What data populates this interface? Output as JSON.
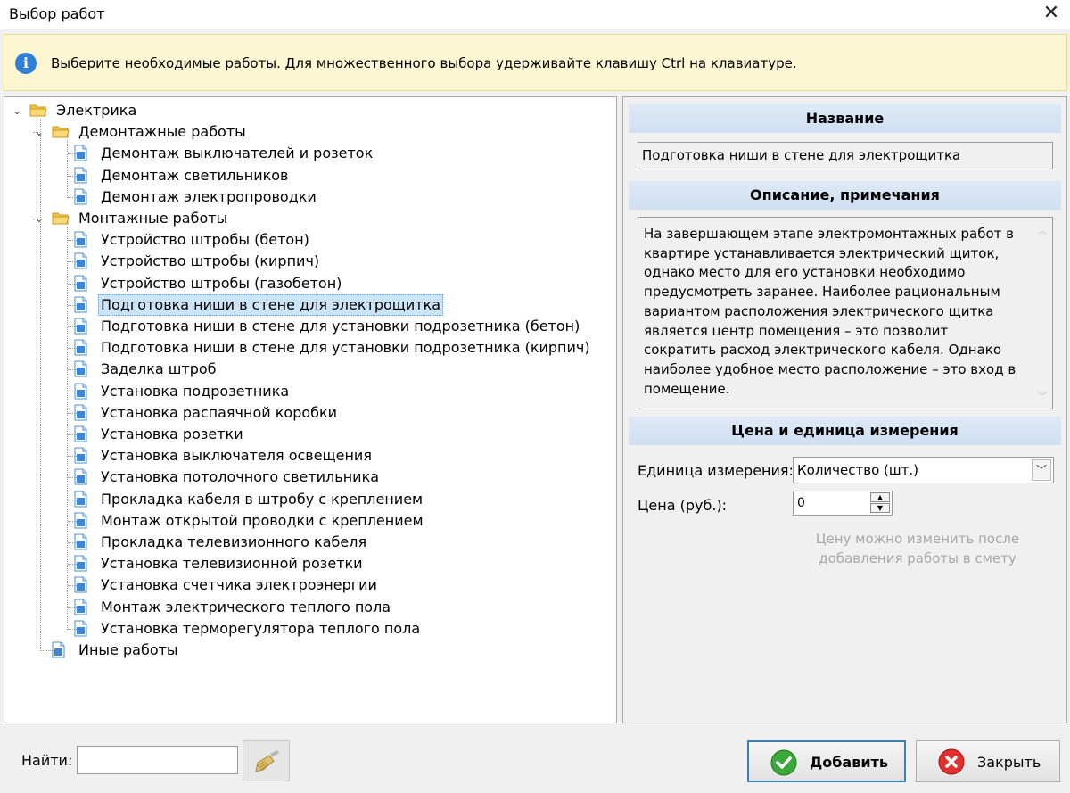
{
  "window": {
    "title": "Выбор работ",
    "close_glyph": "✕"
  },
  "info": {
    "icon": "info-icon",
    "message": "Выберите необходимые работы. Для множественного выбора удерживайте клавишу Ctrl на клавиатуре."
  },
  "tree": {
    "root": {
      "label": "Электрика",
      "expanded": true
    },
    "groups": [
      {
        "label": "Демонтажные работы",
        "expanded": true,
        "items": [
          "Демонтаж выключателей и розеток",
          "Демонтаж светильников",
          "Демонтаж электропроводки"
        ]
      },
      {
        "label": "Монтажные работы",
        "expanded": true,
        "items": [
          "Устройство штробы (бетон)",
          "Устройство штробы (кирпич)",
          "Устройство штробы (газобетон)",
          "Подготовка ниши в стене для электрощитка",
          "Подготовка ниши в стене для установки подрозетника (бетон)",
          "Подготовка ниши в стене для установки подрозетника (кирпич)",
          "Заделка штроб",
          "Установка подрозетника",
          "Установка распаячной коробки",
          "Установка розетки",
          "Установка выключателя освещения",
          "Установка потолочного светильника",
          "Прокладка кабеля в штробу с креплением",
          "Монтаж открытой проводки с креплением",
          "Прокладка телевизионного кабеля",
          "Установка телевизионной розетки",
          "Установка счетчика электроэнергии",
          "Монтаж электрического теплого пола",
          "Установка терморегулятора теплого пола"
        ]
      }
    ],
    "other": {
      "label": "Иные работы"
    },
    "selected": "Подготовка ниши в стене для электрощитка"
  },
  "details": {
    "name_header": "Название",
    "name_value": "Подготовка ниши в стене для электрощитка",
    "desc_header": "Описание, примечания",
    "desc_lines": [
      "На завершающем этапе электромонтажных работ в",
      "квартире устанавливается электрический щиток,",
      "однако место для его установки необходимо",
      "предусмотреть заранее. Наиболее рациональным",
      "вариантом расположения электрического щитка",
      "является центр помещения – это позволит",
      "сократить  расход электрического кабеля. Однако",
      "наиболее удобное место расположение – это вход в",
      "помещение."
    ],
    "price_header": "Цена и единица измерения",
    "unit_label": "Единица измерения:",
    "unit_value": "Количество (шт.)",
    "price_label": "Цена (руб.):",
    "price_value": "0",
    "hint_lines": [
      "Цену можно изменить после",
      "добавления работы в смету"
    ]
  },
  "footer": {
    "find_label": "Найти:",
    "find_value": "",
    "add_label": "Добавить",
    "close_label": "Закрыть"
  },
  "colors": {
    "selection": "#cce4f7",
    "header_bg": "#d6e4f4",
    "info_bg": "#fdf6d2",
    "accent_border": "#3c7fb1"
  }
}
